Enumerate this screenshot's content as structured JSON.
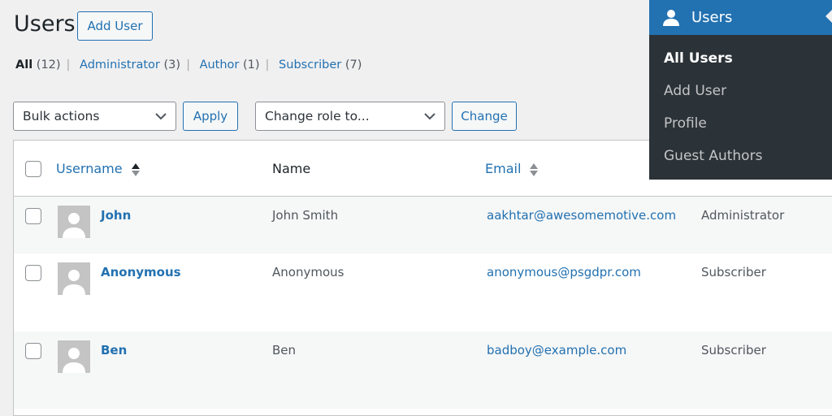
{
  "header": {
    "title": "Users",
    "add_user": "Add User"
  },
  "filters": [
    {
      "label": "All",
      "count": "(12)"
    },
    {
      "label": "Administrator",
      "count": "(3)"
    },
    {
      "label": "Author",
      "count": "(1)"
    },
    {
      "label": "Subscriber",
      "count": "(7)"
    }
  ],
  "toolbar": {
    "bulk_actions": "Bulk actions",
    "apply": "Apply",
    "change_role": "Change role to...",
    "change": "Change"
  },
  "table": {
    "columns": [
      "Username",
      "Name",
      "Email"
    ],
    "rows": [
      {
        "username": "John",
        "name": "John Smith",
        "email": "aakhtar@awesomemotive.com",
        "role": "Administrator"
      },
      {
        "username": "Anonymous",
        "name": "Anonymous",
        "email": "anonymous@psgdpr.com",
        "role": "Subscriber"
      },
      {
        "username": "Ben",
        "name": "Ben",
        "email": "badboy@example.com",
        "role": "Subscriber"
      }
    ]
  },
  "flyout": {
    "title": "Users",
    "items": [
      "All Users",
      "Add User",
      "Profile",
      "Guest Authors"
    ]
  }
}
